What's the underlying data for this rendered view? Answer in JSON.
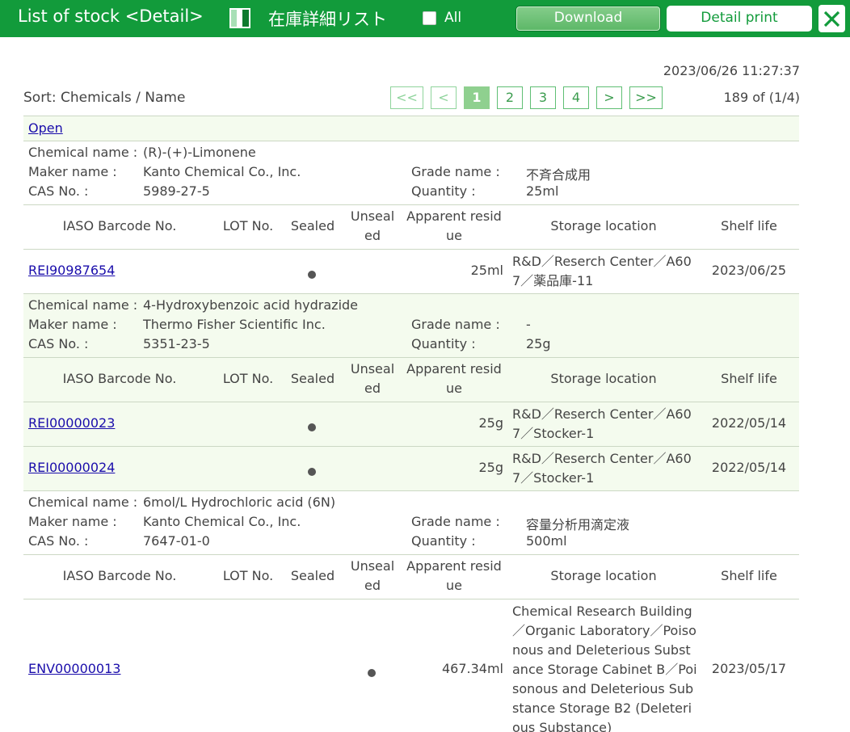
{
  "header": {
    "title": "List of stock <Detail>",
    "jp_title": "在庫詳細リスト",
    "all_label": "All",
    "download_label": "Download",
    "detail_print_label": "Detail print"
  },
  "meta": {
    "timestamp": "2023/06/26 11:27:37",
    "sort": "Sort: Chemicals / Name",
    "count": "189 of (1/4)"
  },
  "pager": [
    "<<",
    "<",
    "1",
    "2",
    "3",
    "4",
    ">",
    ">>"
  ],
  "open_label": "Open",
  "field_labels": {
    "chemical_name": "Chemical name :",
    "maker_name": "Maker name :",
    "cas_no": "CAS No. :",
    "grade_name": "Grade name :",
    "quantity": "Quantity :"
  },
  "columns": {
    "barcode": "IASO Barcode No.",
    "lot": "LOT No.",
    "sealed": "Sealed",
    "unsealed": "Unseal ed",
    "residue": "Apparent resid ue",
    "location": "Storage location",
    "shelf": "Shelf life"
  },
  "chemicals": [
    {
      "name": "(R)-(+)-Limonene",
      "maker": "Kanto Chemical Co., Inc.",
      "cas": "5989-27-5",
      "grade": "不斉合成用",
      "quantity": "25ml",
      "items": [
        {
          "barcode": "REI90987654",
          "lot": "",
          "sealed": true,
          "unsealed": false,
          "residue": "25ml",
          "location": "R&D／Reserch Center／A607／薬品庫-11",
          "shelf": "2023/06/25"
        }
      ]
    },
    {
      "name": "4-Hydroxybenzoic acid hydrazide",
      "maker": "Thermo Fisher Scientific Inc.",
      "cas": "5351-23-5",
      "grade": "-",
      "quantity": "25g",
      "items": [
        {
          "barcode": "REI00000023",
          "lot": "",
          "sealed": true,
          "unsealed": false,
          "residue": "25g",
          "location": "R&D／Reserch Center／A607／Stocker-1",
          "shelf": "2022/05/14"
        },
        {
          "barcode": "REI00000024",
          "lot": "",
          "sealed": true,
          "unsealed": false,
          "residue": "25g",
          "location": "R&D／Reserch Center／A607／Stocker-1",
          "shelf": "2022/05/14"
        }
      ]
    },
    {
      "name": "6mol/L Hydrochloric acid (6N)",
      "maker": "Kanto Chemical Co., Inc.",
      "cas": "7647-01-0",
      "grade": "容量分析用滴定液",
      "quantity": "500ml",
      "items": [
        {
          "barcode": "ENV00000013",
          "lot": "",
          "sealed": false,
          "unsealed": true,
          "residue": "467.34ml",
          "location": "Chemical Research Building／Organic Laboratory／Poisonous and Deleterious Substance Storage Cabinet B／Poisonous and Deleterious Substance Storage B2 (Deleterious Substance)",
          "shelf": "2023/05/17"
        }
      ]
    }
  ]
}
